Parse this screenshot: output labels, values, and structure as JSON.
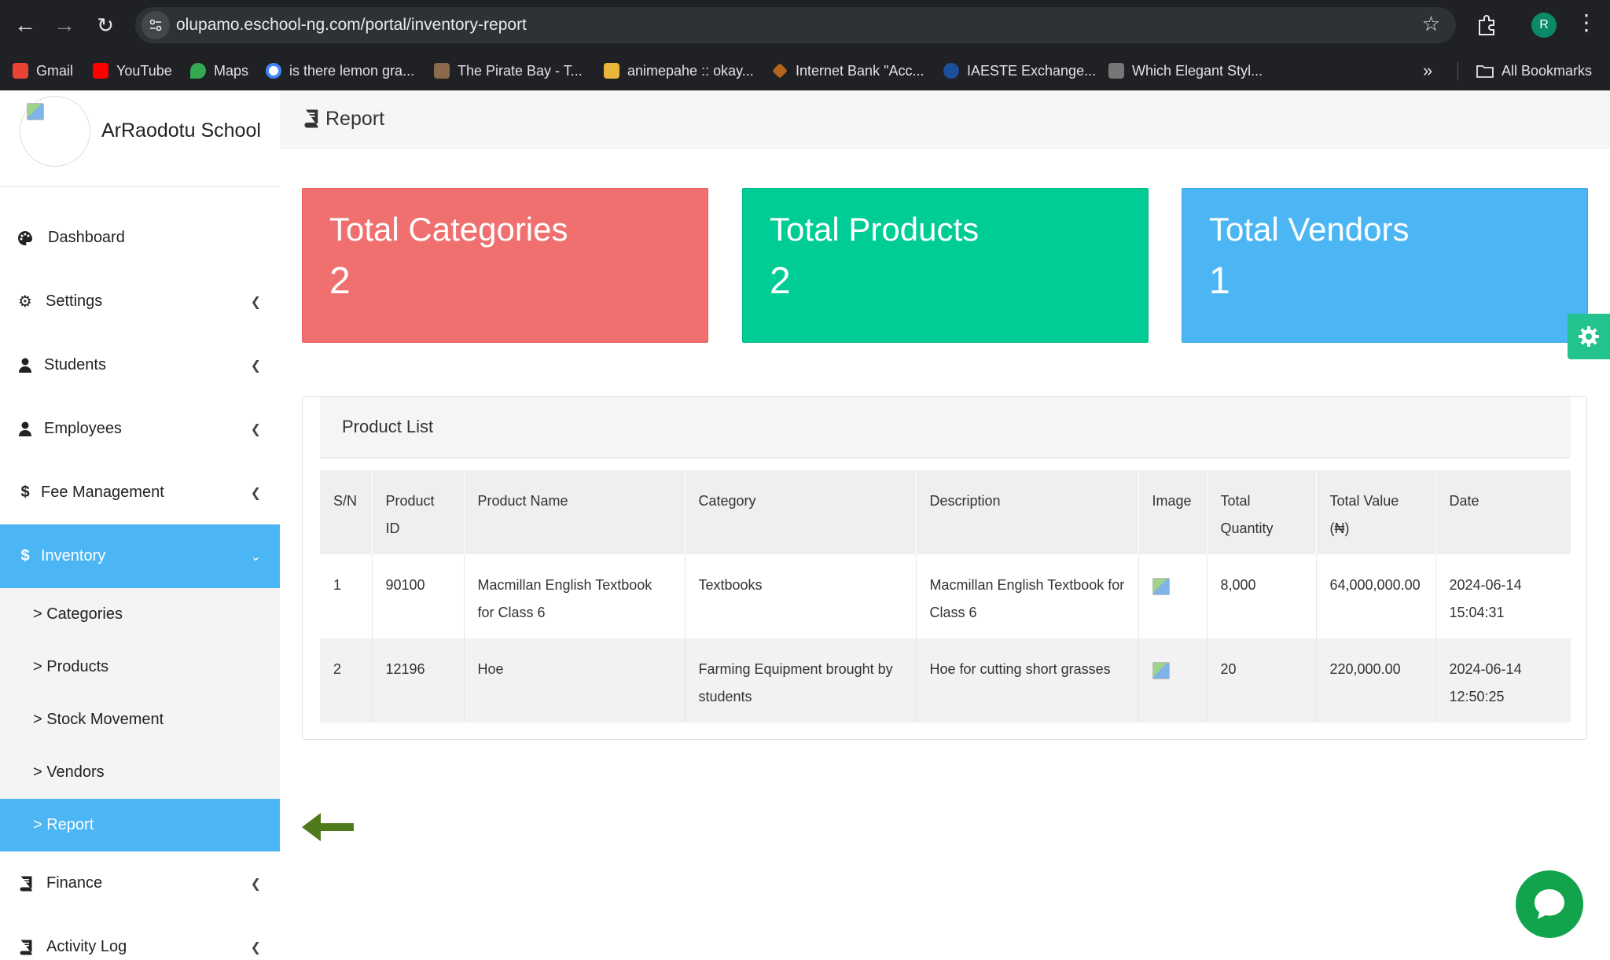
{
  "browser": {
    "url": "olupamo.eschool-ng.com/portal/inventory-report",
    "profile_initial": "R",
    "bookmarks": [
      {
        "label": "Gmail",
        "color": "#ea4335"
      },
      {
        "label": "YouTube",
        "color": "#ff0000"
      },
      {
        "label": "Maps",
        "color": "#34a853"
      },
      {
        "label": "is there lemon gra...",
        "color": "#4285f4"
      },
      {
        "label": "The Pirate Bay - T...",
        "color": "#8a6a4a"
      },
      {
        "label": "animepahe :: okay...",
        "color": "#e8b73a"
      },
      {
        "label": "Internet Bank \"Acc...",
        "color": "#b5651d"
      },
      {
        "label": "IAESTE Exchange...",
        "color": "#1b4f9c"
      },
      {
        "label": "Which Elegant Styl...",
        "color": "#777777"
      }
    ],
    "all_bookmarks": "All Bookmarks"
  },
  "sidebar": {
    "school_name": "ArRaodotu School",
    "items": [
      {
        "label": "Dashboard",
        "icon": "palette-icon"
      },
      {
        "label": "Settings",
        "icon": "gear-icon"
      },
      {
        "label": "Students",
        "icon": "user-icon"
      },
      {
        "label": "Employees",
        "icon": "user-icon"
      },
      {
        "label": "Fee Management",
        "icon": "dollar-icon"
      },
      {
        "label": "Inventory",
        "icon": "dollar-icon"
      },
      {
        "label": "Finance",
        "icon": "book-icon"
      },
      {
        "label": "Activity Log",
        "icon": "book-icon"
      }
    ],
    "sub_items": [
      {
        "label": "> Categories"
      },
      {
        "label": "> Products"
      },
      {
        "label": "> Stock Movement"
      },
      {
        "label": "> Vendors"
      },
      {
        "label": "> Report"
      }
    ]
  },
  "header": {
    "title": "Report"
  },
  "stats": [
    {
      "label": "Total Categories",
      "value": "2",
      "color": "#f07070"
    },
    {
      "label": "Total Products",
      "value": "2",
      "color": "#00cc96"
    },
    {
      "label": "Total Vendors",
      "value": "1",
      "color": "#4cb6f5"
    }
  ],
  "product_list": {
    "title": "Product List",
    "columns": [
      "S/N",
      "Product ID",
      "Product Name",
      "Category",
      "Description",
      "Image",
      "Total Quantity",
      "Total Value (₦)",
      "Date"
    ],
    "rows": [
      {
        "sn": "1",
        "id": "90100",
        "name": "Macmillan English Textbook for Class 6",
        "category": "Textbooks",
        "description": "Macmillan English Textbook for Class 6",
        "quantity": "8,000",
        "value": "64,000,000.00",
        "date": "2024-06-14 15:04:31"
      },
      {
        "sn": "2",
        "id": "12196",
        "name": "Hoe",
        "category": "Farming Equipment brought by students",
        "description": "Hoe for cutting short grasses",
        "quantity": "20",
        "value": "220,000.00",
        "date": "2024-06-14 12:50:25"
      }
    ]
  }
}
